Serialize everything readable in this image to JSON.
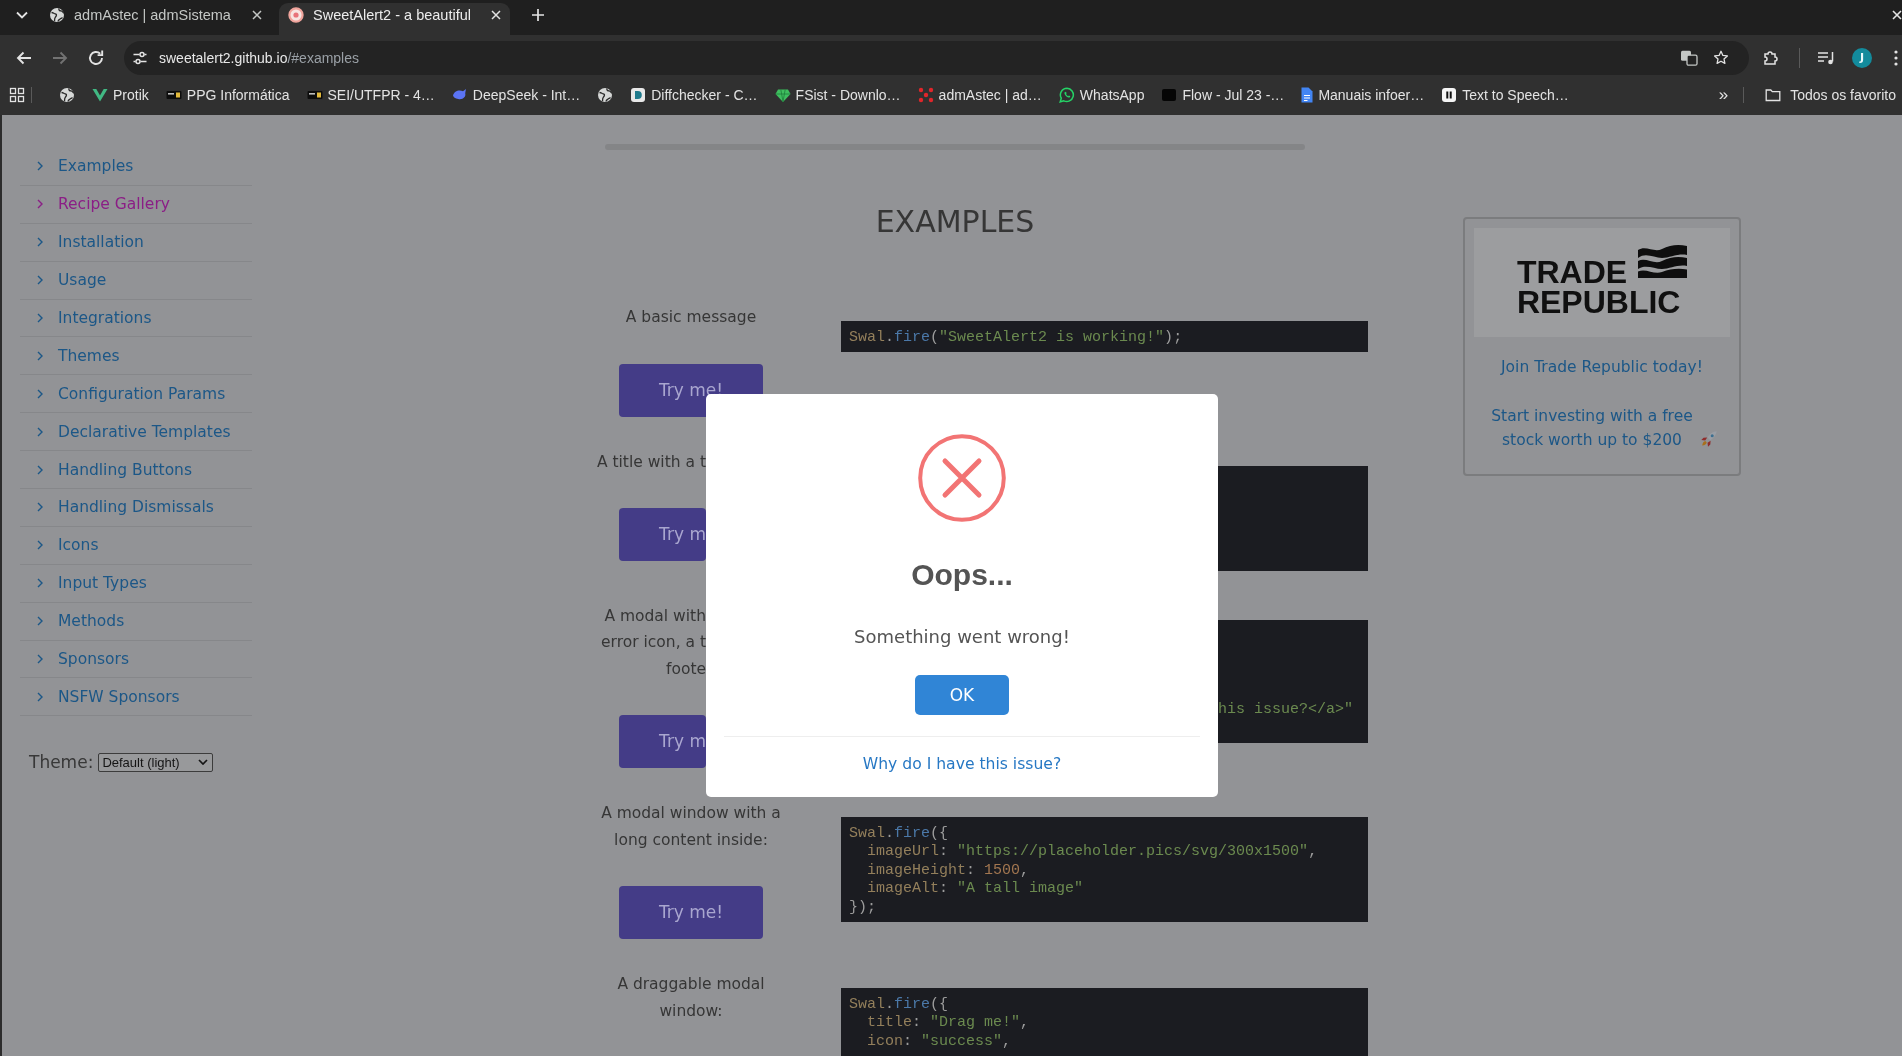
{
  "tabs": [
    {
      "title": "admAstec | admSistema",
      "selected": false
    },
    {
      "title": "SweetAlert2 - a beautiful",
      "selected": true
    }
  ],
  "toolbar": {
    "navigation": [
      {
        "kind": "back",
        "disabled": false
      },
      {
        "kind": "forward",
        "disabled": true
      },
      {
        "kind": "reload",
        "disabled": false
      }
    ],
    "address": "sweetalert2.github.io/#examples",
    "profile_initial": "J"
  },
  "bookmarks_bar": {
    "items": [
      {
        "kind": "icon"
      },
      {
        "kind": "link",
        "label": "Protik"
      },
      {
        "kind": "link",
        "label": "PPG Informática"
      },
      {
        "kind": "link",
        "label": "SEI/UTFPR - 4…"
      },
      {
        "kind": "link",
        "label": "DeepSeek - Int…"
      },
      {
        "kind": "icon"
      },
      {
        "kind": "link",
        "label": "Diffchecker - C…"
      },
      {
        "kind": "link",
        "label": "FSist - Downlo…"
      },
      {
        "kind": "link",
        "label": "admAstec | ad…"
      },
      {
        "kind": "link",
        "label": "WhatsApp"
      },
      {
        "kind": "link",
        "label": "Flow - Jul 23 -…"
      },
      {
        "kind": "link",
        "label": "Manuais infoer…"
      },
      {
        "kind": "link",
        "label": "Text to Speech…"
      }
    ],
    "overflow": "»",
    "folder": "Todos os favorito"
  },
  "sidebar": {
    "items": [
      {
        "label": "Examples",
        "highlighted": false
      },
      {
        "label": "Recipe Gallery",
        "highlighted": true
      },
      {
        "label": "Installation",
        "highlighted": false
      },
      {
        "label": "Usage",
        "highlighted": false
      },
      {
        "label": "Integrations",
        "highlighted": false
      },
      {
        "label": "Themes",
        "highlighted": false
      },
      {
        "label": "Configuration Params",
        "highlighted": false
      },
      {
        "label": "Declarative Templates",
        "highlighted": false
      },
      {
        "label": "Handling Buttons",
        "highlighted": false
      },
      {
        "label": "Handling Dismissals",
        "highlighted": false
      },
      {
        "label": "Icons",
        "highlighted": false
      },
      {
        "label": "Input Types",
        "highlighted": false
      },
      {
        "label": "Methods",
        "highlighted": false
      },
      {
        "label": "Sponsors",
        "highlighted": false
      },
      {
        "label": "NSFW Sponsors",
        "highlighted": false
      }
    ],
    "theme": {
      "label": "Theme:",
      "value": "Default (light)"
    }
  },
  "main": {
    "heading": "EXAMPLES",
    "examples": [
      {
        "description": [
          "A basic message"
        ],
        "button": "Try me!",
        "code": [
          "Swal.fire(\"SweetAlert2 is working!\");"
        ]
      },
      {
        "description": [
          "A title with a t"
        ],
        "button": "Try m"
      },
      {
        "description": [
          "A modal with",
          "error icon, a t",
          "foote"
        ],
        "button": "Try m",
        "code": [
          "his issue?</a>\""
        ]
      },
      {
        "description": [
          "A modal window with a long content inside:"
        ],
        "button": "Try me!",
        "code": [
          "Swal.fire({",
          "  imageUrl: \"https://placeholder.pics/svg/300x1500\",",
          "  imageHeight: 1500,",
          "  imageAlt: \"A tall image\"",
          "});"
        ]
      },
      {
        "description": [
          "A draggable modal window:"
        ],
        "code": [
          "Swal.fire({",
          "  title: \"Drag me!\",",
          "  icon: \"success\","
        ]
      }
    ]
  },
  "ad": {
    "logo": [
      "TRADE",
      "REPUBLIC"
    ],
    "headline": "Join Trade Republic today!",
    "text": "Start investing with a free stock worth up to $200"
  },
  "dialog": {
    "title": "Oops...",
    "text": "Something went wrong!",
    "confirm": "OK",
    "footer_link": "Why do I have this issue?"
  }
}
